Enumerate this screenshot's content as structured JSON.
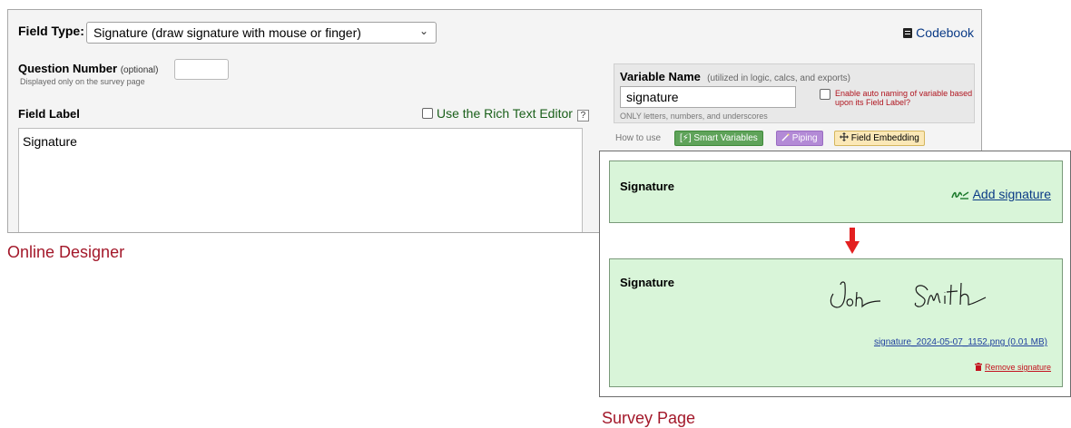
{
  "designer": {
    "field_type_label": "Field Type:",
    "field_type_value": "Signature (draw signature with mouse or finger)",
    "codebook_label": "Codebook",
    "question_number_label": "Question Number",
    "question_number_optional": "(optional)",
    "question_number_hint": "Displayed only on the survey page",
    "field_label_heading": "Field Label",
    "rich_text_label": "Use the Rich Text Editor",
    "help_label": "?",
    "field_label_value": "Signature",
    "variable_name_title": "Variable Name",
    "variable_name_util": "(utilized in logic, calcs, and exports)",
    "variable_name_value": "signature",
    "variable_name_hint": "ONLY letters, numbers, and underscores",
    "auto_naming_label": "Enable auto naming of variable based upon its Field Label?",
    "how_to_use": "How to use",
    "smart_variables_label": "[⚡] Smart Variables",
    "piping_label": "Piping",
    "field_embedding_label": "Field Embedding",
    "colors": {
      "smart_variables": "#5fa35a",
      "piping": "#b38ad6",
      "field_embedding": "#fbe8b7"
    }
  },
  "survey": {
    "top_field_label": "Signature",
    "add_signature_label": "Add signature",
    "bottom_field_label": "Signature",
    "signature_file_link": "signature_2024-05-07_1152.png (0.01 MB)",
    "remove_signature_label": "Remove signature",
    "colors": {
      "field_background": "#d9f5d9",
      "arrow": "#e32020"
    }
  },
  "captions": {
    "online_designer": "Online Designer",
    "survey_page": "Survey Page",
    "color": "#a3182a"
  },
  "icons": [
    "chevron-down-icon",
    "book-icon",
    "signature-pen-icon",
    "arrow-down-icon",
    "trash-icon",
    "wand-icon",
    "move-icon"
  ]
}
